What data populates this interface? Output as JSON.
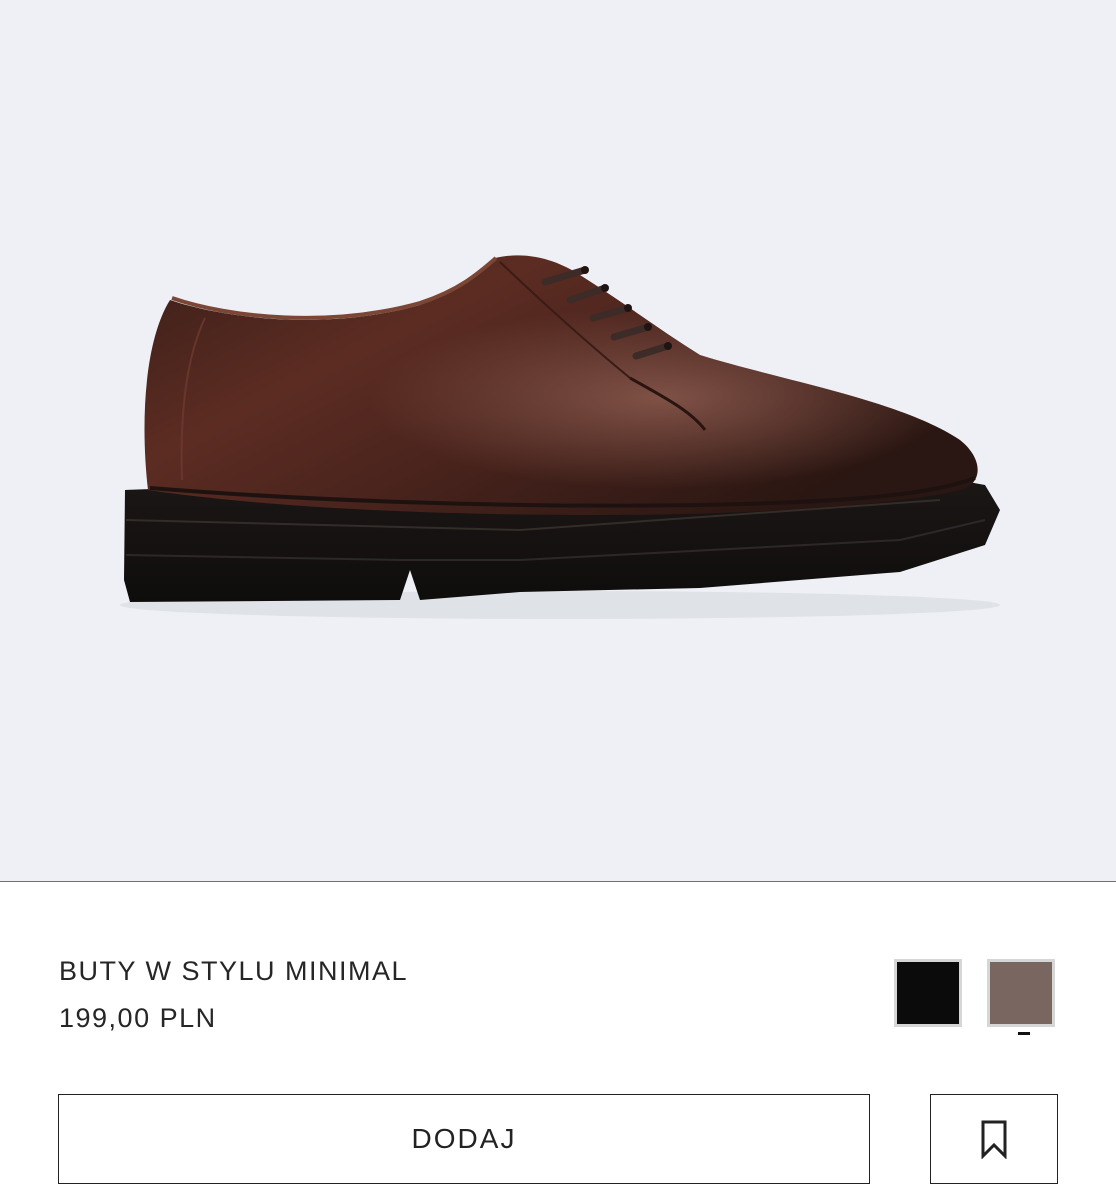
{
  "product": {
    "title": "BUTY W STYLU MINIMAL",
    "price": "199,00 PLN",
    "image_subject": "shoe-photo"
  },
  "colors": [
    {
      "name": "black",
      "hex": "#0b0b0b",
      "selected": false
    },
    {
      "name": "brown",
      "hex": "#7a6661",
      "selected": true
    }
  ],
  "actions": {
    "add_label": "DODAJ",
    "bookmark_icon": "bookmark-icon"
  },
  "theme": {
    "background": "#eef0f5",
    "accent": "#222222"
  }
}
